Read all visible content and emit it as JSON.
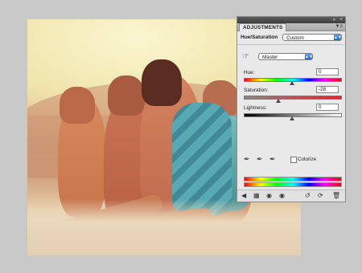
{
  "panel": {
    "tab_label": "ADJUSTMENTS",
    "preset_title": "Hue/Saturation",
    "preset_value": "Custom",
    "channel_value": "Master",
    "hue": {
      "label": "Hue:",
      "value": "0",
      "level": 0.5
    },
    "saturation": {
      "label": "Saturation:",
      "value": "-28",
      "level": 0.36
    },
    "lightness": {
      "label": "Lightness:",
      "value": "0",
      "level": 0.5
    },
    "colorize_label": "Colorize",
    "titlebar_controls": [
      "«",
      "×"
    ],
    "icons": {
      "targeted_adjustment": "hand-icon",
      "eyedroppers": [
        "eyedropper-icon",
        "eyedropper-plus-icon",
        "eyedropper-minus-icon"
      ],
      "footer_left": [
        "back-arrow-icon",
        "expand-icon",
        "clip-layer-icon",
        "visibility-eye-icon"
      ],
      "footer_right": [
        "previous-state-icon",
        "reset-icon",
        "trash-icon"
      ]
    }
  }
}
